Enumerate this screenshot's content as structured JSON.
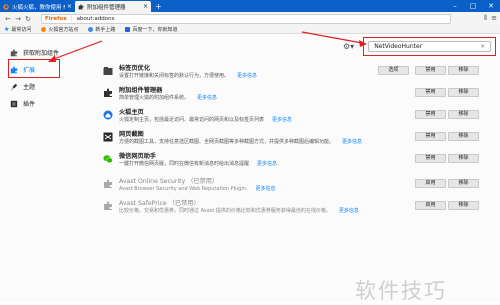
{
  "tabs": [
    {
      "label": "火狐火狐，教你使用 Firefox",
      "active": false
    },
    {
      "label": "附加组件管理器",
      "active": true
    }
  ],
  "nav": {
    "brand": "Firefox",
    "url": "about:addons"
  },
  "bookmarks": [
    {
      "label": "最常访问",
      "icon": "star-icon"
    },
    {
      "label": "火狐官方站点",
      "icon": "firefox-icon"
    },
    {
      "label": "新手上路",
      "icon": "globe-icon"
    },
    {
      "label": "百度一下，你就知道",
      "icon": "baidu-icon"
    }
  ],
  "sidebar": {
    "items": [
      {
        "label": "获取附加组件",
        "icon": "puzzle-get-icon"
      },
      {
        "label": "扩展",
        "icon": "puzzle-extensions-icon",
        "active": true
      },
      {
        "label": "主题",
        "icon": "brush-icon"
      },
      {
        "label": "插件",
        "icon": "plugin-block-icon"
      }
    ]
  },
  "search": {
    "value": "NetVideoHunter"
  },
  "addons": [
    {
      "name": "标签页优化",
      "desc": "设置打开链接和关闭标签的默认行为，方便使用。",
      "more": "更多信息",
      "buttons": [
        "选项",
        "禁用",
        "移除"
      ],
      "icon": "tab-icon"
    },
    {
      "name": "附加组件管理器",
      "desc": "简单管理火狐的附加组件系统。",
      "more": "更多信息",
      "buttons": [
        "禁用",
        "移除"
      ],
      "icon": "puzzle-icon"
    },
    {
      "name": "火狐主页",
      "desc": "火狐定制主页，包括最近访问、最常访问的网页和以及标签页列表",
      "more": "更多信息",
      "buttons": [
        "禁用",
        "移除"
      ],
      "icon": "home-icon"
    },
    {
      "name": "网页截图",
      "desc": "方便的截图工具，支持任意选区截图、全网页截图等多种截图方式，并提供多种截图后编辑功能。",
      "more": "更多信息",
      "buttons": [
        "禁用",
        "移除"
      ],
      "icon": "scissors-icon"
    },
    {
      "name": "微信网页助手",
      "desc": "一键打开微信网页版，同时在微信有新消息时给出消息提醒",
      "more": "更多信息",
      "buttons": [
        "禁用",
        "移除"
      ],
      "icon": "wechat-icon"
    },
    {
      "name": "Avast Online Security （已禁用）",
      "desc": "Avast Browser Security and Web Reputation Plugin.",
      "more": "更多信息",
      "buttons": [
        "启用",
        "移除"
      ],
      "icon": "avast-puzzle-icon",
      "disabled": true
    },
    {
      "name": "Avast SafePrice （已禁用）",
      "desc": "比较价格、交易和优惠券，同时通过 Avast 提供的价格比较和优惠券服务获得最佳的在线价格。",
      "more": "更多信息",
      "buttons": [
        "启用",
        "移除"
      ],
      "icon": "avast-puzzle-icon",
      "disabled": true
    }
  ],
  "watermark": "软件技巧",
  "colors": {
    "tabbar": "#0b60c8",
    "accent": "#0a84ff",
    "highlight": "#e02020"
  }
}
